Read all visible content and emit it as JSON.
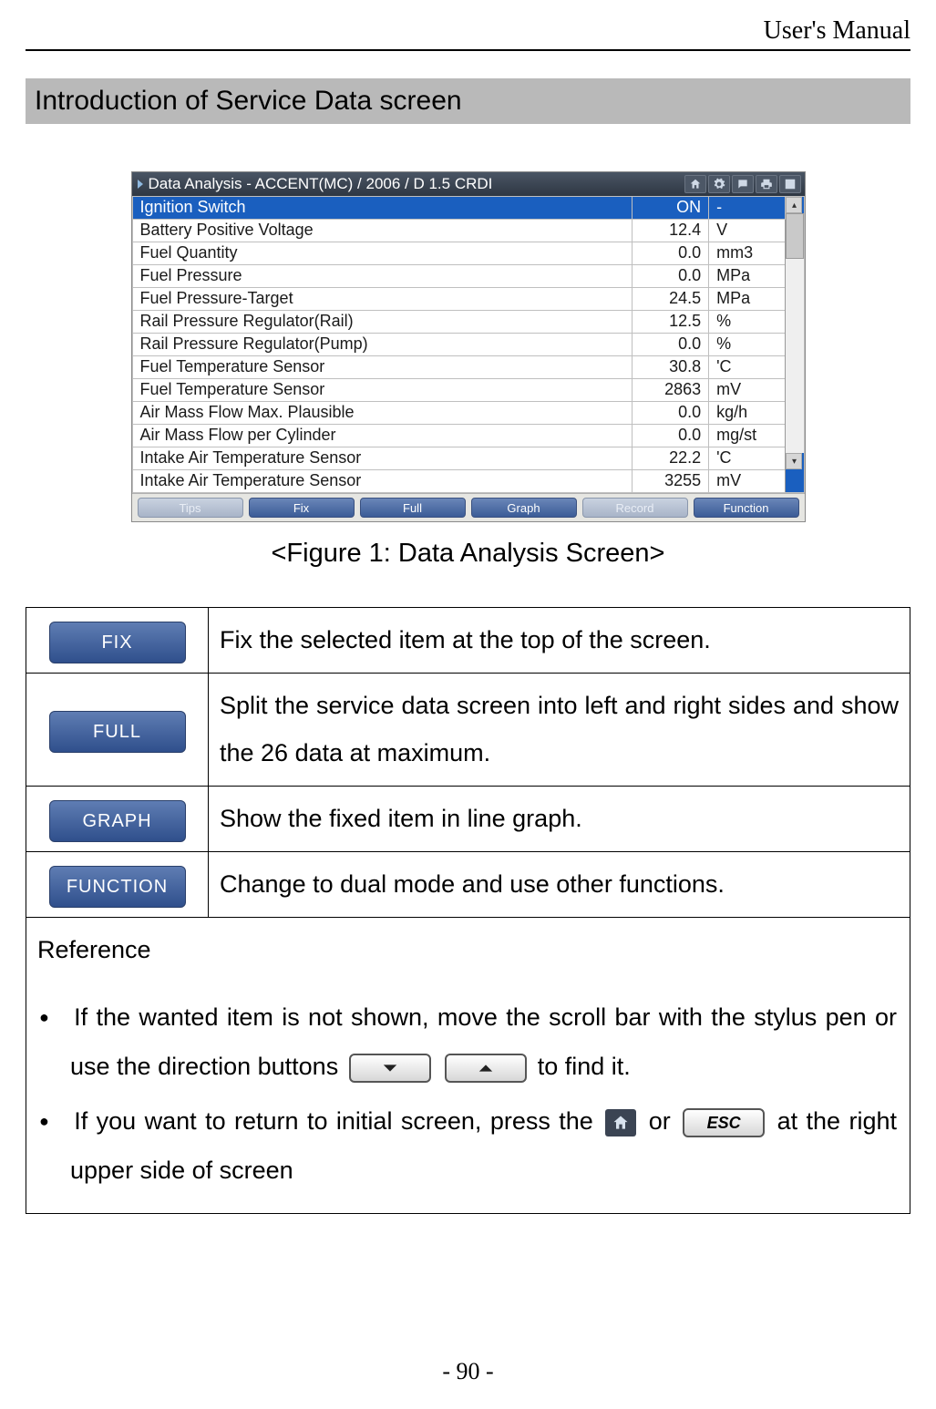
{
  "header": {
    "title": "User's Manual"
  },
  "section": {
    "title": "Introduction of Service Data screen"
  },
  "figure": {
    "window_title": "Data Analysis - ACCENT(MC) / 2006 / D 1.5 CRDI",
    "rows": [
      {
        "name": "Ignition Switch",
        "value": "ON",
        "unit": "-"
      },
      {
        "name": "Battery Positive Voltage",
        "value": "12.4",
        "unit": "V"
      },
      {
        "name": "Fuel Quantity",
        "value": "0.0",
        "unit": "mm3"
      },
      {
        "name": "Fuel Pressure",
        "value": "0.0",
        "unit": "MPa"
      },
      {
        "name": "Fuel Pressure-Target",
        "value": "24.5",
        "unit": "MPa"
      },
      {
        "name": "Rail Pressure Regulator(Rail)",
        "value": "12.5",
        "unit": "%"
      },
      {
        "name": "Rail Pressure Regulator(Pump)",
        "value": "0.0",
        "unit": "%"
      },
      {
        "name": "Fuel Temperature Sensor",
        "value": "30.8",
        "unit": "'C"
      },
      {
        "name": "Fuel Temperature Sensor",
        "value": "2863",
        "unit": "mV"
      },
      {
        "name": "Air Mass Flow Max. Plausible",
        "value": "0.0",
        "unit": "kg/h"
      },
      {
        "name": "Air Mass Flow per Cylinder",
        "value": "0.0",
        "unit": "mg/st"
      },
      {
        "name": "Intake Air Temperature Sensor",
        "value": "22.2",
        "unit": "'C"
      },
      {
        "name": "Intake Air Temperature Sensor",
        "value": "3255",
        "unit": "mV"
      }
    ],
    "toolbar": {
      "tips": "Tips",
      "fix": "Fix",
      "full": "Full",
      "graph": "Graph",
      "record": "Record",
      "function": "Function"
    },
    "caption": "<Figure 1: Data Analysis Screen>"
  },
  "buttons": {
    "fix": {
      "label": "FIX",
      "desc": "Fix the selected item at the top of the screen."
    },
    "full": {
      "label": "FULL",
      "desc": "Split the service data screen into left and right sides and show the 26 data at maximum."
    },
    "graph": {
      "label": "GRAPH",
      "desc": "Show the fixed item in line graph."
    },
    "function": {
      "label": "FUNCTION",
      "desc": "Change to dual mode and use other functions."
    }
  },
  "reference": {
    "title": "Reference",
    "item1_a": "If the wanted item is not shown, move the scroll bar with the stylus pen or use the direction buttons",
    "item1_b": "to find it.",
    "item2_a": "If you want to return to initial screen, press the",
    "item2_b": "or",
    "item2_c": "at the right upper side of screen",
    "esc_label": "ESC"
  },
  "footer": {
    "page": "- 90 -"
  }
}
